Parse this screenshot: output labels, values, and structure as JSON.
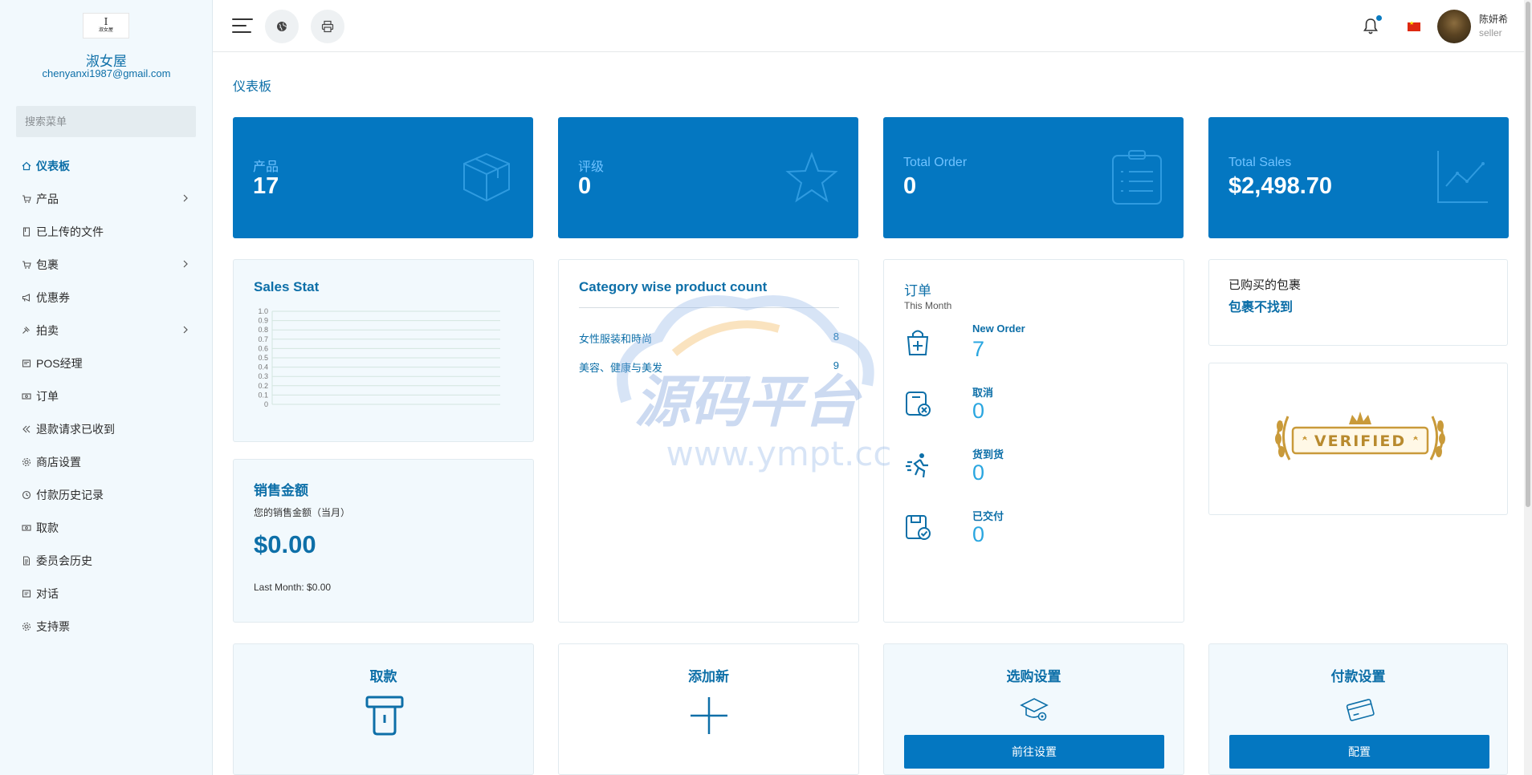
{
  "sidebar": {
    "logo_text": "淑女屋",
    "shop_name": "淑女屋",
    "email": "chenyanxi1987@gmail.com",
    "search_placeholder": "搜索菜单",
    "items": [
      {
        "label": "仪表板",
        "icon": "home-icon",
        "active": true,
        "has_children": false
      },
      {
        "label": "产品",
        "icon": "cart-icon",
        "active": false,
        "has_children": true
      },
      {
        "label": "已上传的文件",
        "icon": "file-icon",
        "active": false,
        "has_children": false
      },
      {
        "label": "包裹",
        "icon": "cart-icon",
        "active": false,
        "has_children": true
      },
      {
        "label": "优惠券",
        "icon": "megaphone-icon",
        "active": false,
        "has_children": false
      },
      {
        "label": "拍卖",
        "icon": "gavel-icon",
        "active": false,
        "has_children": true
      },
      {
        "label": "POS经理",
        "icon": "pos-icon",
        "active": false,
        "has_children": false
      },
      {
        "label": "订单",
        "icon": "money-icon",
        "active": false,
        "has_children": false
      },
      {
        "label": "退款请求已收到",
        "icon": "refund-icon",
        "active": false,
        "has_children": false
      },
      {
        "label": "商店设置",
        "icon": "gear-icon",
        "active": false,
        "has_children": false
      },
      {
        "label": "付款历史记录",
        "icon": "history-icon",
        "active": false,
        "has_children": false
      },
      {
        "label": "取款",
        "icon": "money-icon",
        "active": false,
        "has_children": false
      },
      {
        "label": "委员会历史",
        "icon": "document-icon",
        "active": false,
        "has_children": false
      },
      {
        "label": "对话",
        "icon": "chat-icon",
        "active": false,
        "has_children": false
      },
      {
        "label": "支持票",
        "icon": "gear-icon",
        "active": false,
        "has_children": false
      }
    ]
  },
  "topbar": {
    "user_name": "陈妍希",
    "user_role": "seller",
    "flag": "china-flag",
    "has_notification": true
  },
  "page_title": "仪表板",
  "stats": [
    {
      "label": "产品",
      "value": "17",
      "icon": "box-icon"
    },
    {
      "label": "评级",
      "value": "0",
      "icon": "star-icon"
    },
    {
      "label": "Total Order",
      "value": "0",
      "icon": "clipboard-icon"
    },
    {
      "label": "Total Sales",
      "value": "$2,498.70",
      "icon": "trend-chart-icon"
    }
  ],
  "sales_stat": {
    "title": "Sales Stat"
  },
  "chart_data": {
    "type": "line",
    "title": "Sales Stat",
    "xlabel": "",
    "ylabel": "",
    "ylim": [
      0,
      1.0
    ],
    "yticks": [
      "1.0",
      "0.9",
      "0.8",
      "0.7",
      "0.6",
      "0.5",
      "0.4",
      "0.3",
      "0.2",
      "0.1",
      "0"
    ],
    "series": [],
    "grid": true
  },
  "category_count": {
    "title": "Category wise product count",
    "rows": [
      {
        "name": "女性服装和時尚",
        "count": "8"
      },
      {
        "name": "美容、健康与美发",
        "count": "9"
      }
    ]
  },
  "orders": {
    "title": "订单",
    "subtitle": "This Month",
    "items": [
      {
        "label": "New Order",
        "value": "7",
        "icon": "shopping-bag-icon"
      },
      {
        "label": "取消",
        "value": "0",
        "icon": "cancel-box-icon"
      },
      {
        "label": "货到货",
        "value": "0",
        "icon": "running-delivery-icon"
      },
      {
        "label": "已交付",
        "value": "0",
        "icon": "delivered-box-icon"
      }
    ]
  },
  "purchased_package": {
    "label": "已购买的包裹",
    "value": "包裹不找到"
  },
  "verified": {
    "badge_text": "VERIFIED"
  },
  "sales_amount": {
    "title": "销售金额",
    "subtitle": "您的销售金额（当月）",
    "amount": "$0.00",
    "last_month": "Last Month: $0.00"
  },
  "bottom_cards": [
    {
      "title": "取款",
      "icon": "withdraw-icon"
    },
    {
      "title": "添加新",
      "icon": "plus-icon"
    },
    {
      "title": "选购设置",
      "icon": "settings-cap-icon",
      "button": "前往设置"
    },
    {
      "title": "付款设置",
      "icon": "payment-card-icon",
      "button": "配置"
    }
  ],
  "watermark": {
    "text_cn": "源码平台",
    "text_url": "www.ympt.cc"
  }
}
